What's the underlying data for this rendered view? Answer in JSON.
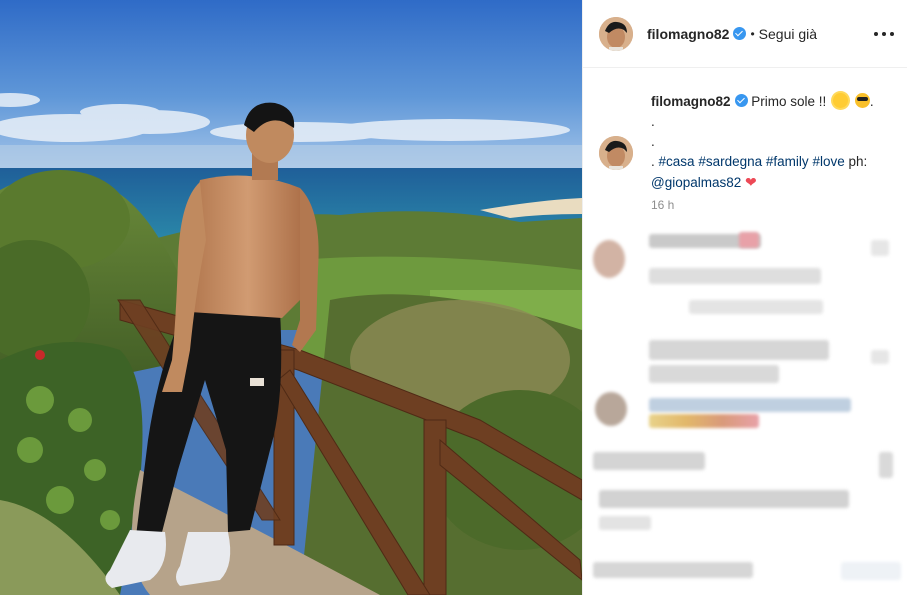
{
  "header": {
    "username": "filomagno82",
    "separator": "•",
    "follow_status": "Segui già"
  },
  "caption": {
    "username": "filomagno82",
    "line1": "Primo sole !!",
    "dot1": ".",
    "dot2": ".",
    "dot3": ".",
    "hashtags": [
      "#casa",
      "#sardegna",
      "#family",
      "#love"
    ],
    "photo_credit_prefix": "ph:",
    "mention": "@giopalmas82",
    "heart": "❤",
    "emojis": [
      "sun-emoji",
      "sunglasses-emoji"
    ]
  },
  "timestamp": "16 h",
  "icons": {
    "verified": "verified-badge-icon",
    "more": "more-options-icon",
    "heart": "heart-icon"
  },
  "colors": {
    "link": "#00376b",
    "verified": "#3897f0",
    "muted": "#8e8e8e",
    "heart": "#ed4956"
  }
}
